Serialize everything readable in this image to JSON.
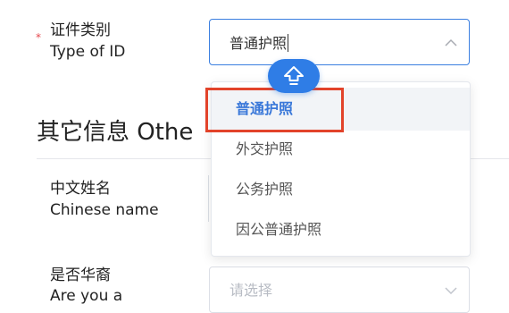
{
  "form": {
    "type_of_id": {
      "required_mark": "*",
      "label_cn": "证件类别",
      "label_en": "Type of ID",
      "value": "普通护照"
    },
    "section": {
      "title": "其它信息 Othe"
    },
    "chinese_name": {
      "label_cn": "中文姓名",
      "label_en": "Chinese name"
    },
    "overseas_chinese": {
      "label_cn": "是否华裔",
      "label_en": "Are you a",
      "placeholder": "请选择"
    }
  },
  "dropdown": {
    "options": [
      "普通护照",
      "外交护照",
      "公务护照",
      "因公普通护照"
    ],
    "selected_index": 0
  },
  "icons": {
    "chevron": "chevron-up-icon",
    "chevron_inactive": "chevron-down-icon",
    "keyboard_toggle": "arrow-up-icon"
  },
  "colors": {
    "accent": "#3b7fe0",
    "selected_text": "#3a78d9",
    "required": "#e5484d",
    "highlight_box": "#e2432a",
    "keyboard_button": "#2f7de6"
  }
}
